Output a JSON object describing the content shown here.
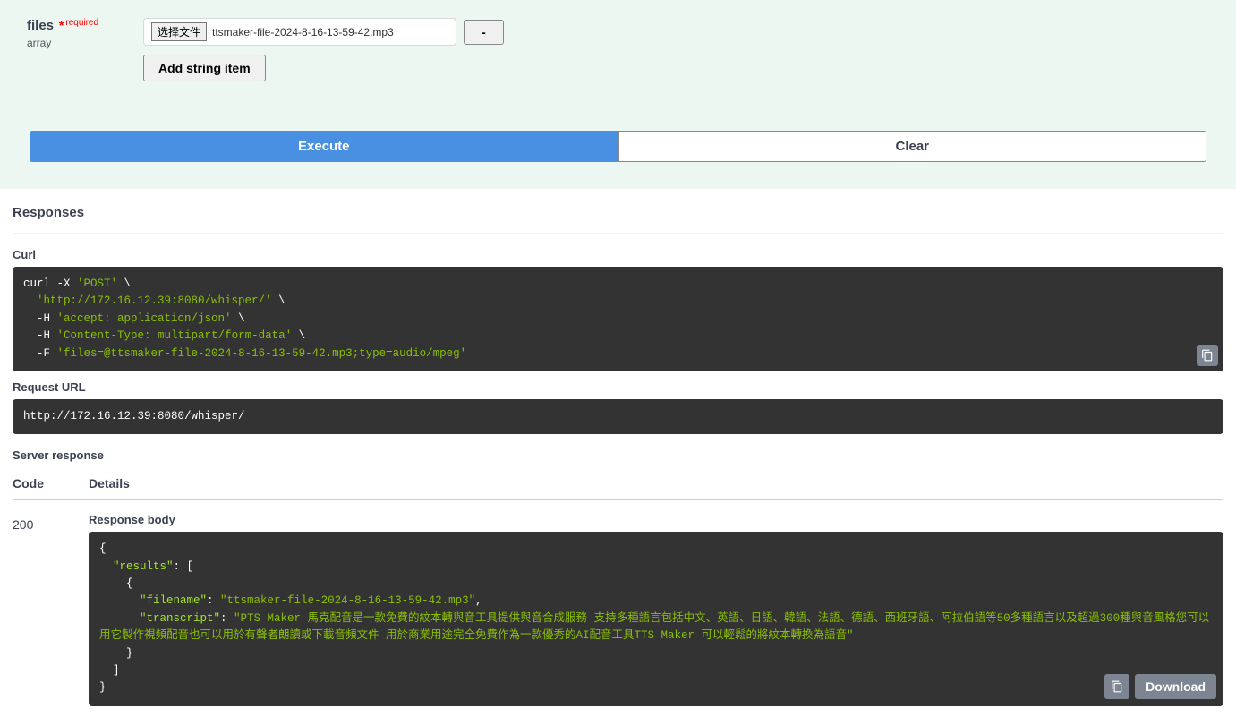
{
  "parameters": {
    "name": "files",
    "required_label": "required",
    "type": "array",
    "choose_file_label": "选择文件",
    "file_name": "ttsmaker-file-2024-8-16-13-59-42.mp3",
    "remove_label": "-",
    "add_item_label": "Add string item"
  },
  "buttons": {
    "execute": "Execute",
    "clear": "Clear",
    "download": "Download"
  },
  "responses": {
    "title": "Responses",
    "curl_label": "Curl",
    "curl_command": {
      "l1a": "curl -X ",
      "l1b": "'POST'",
      "l1c": " \\",
      "l2a": "  ",
      "l2b": "'http://172.16.12.39:8080/whisper/'",
      "l2c": " \\",
      "l3a": "  -H ",
      "l3b": "'accept: application/json'",
      "l3c": " \\",
      "l4a": "  -H ",
      "l4b": "'Content-Type: multipart/form-data'",
      "l4c": " \\",
      "l5a": "  -F ",
      "l5b": "'files=@ttsmaker-file-2024-8-16-13-59-42.mp3;type=audio/mpeg'"
    },
    "request_url_label": "Request URL",
    "request_url": "http://172.16.12.39:8080/whisper/",
    "server_response_label": "Server response",
    "code_label": "Code",
    "details_label": "Details",
    "status_code": "200",
    "response_body_label": "Response body",
    "response_body": {
      "p1": "{",
      "p2": "  \"results\"",
      "p2b": ": [",
      "p3": "    {",
      "p4": "      \"filename\"",
      "p4b": ": ",
      "p4c": "\"ttsmaker-file-2024-8-16-13-59-42.mp3\"",
      "p4d": ",",
      "p5": "      \"transcript\"",
      "p5b": ": ",
      "p5c": "\"PTS Maker 馬克配音是一款免費的紋本轉與音工具提供與音合成服務 支持多種語言包括中文、英語、日語、韓語、法語、德語、西班牙語、阿拉伯語等50多種語言以及超過300種與音風格您可以用它製作視頻配音也可以用於有聲者朗讀或下載音頻文件 用於商業用途完全免費作為一款優秀的AI配音工具TTS Maker 可以輕鬆的將紋本轉換為語音\"",
      "p6": "    }",
      "p7": "  ]",
      "p8": "}"
    }
  }
}
